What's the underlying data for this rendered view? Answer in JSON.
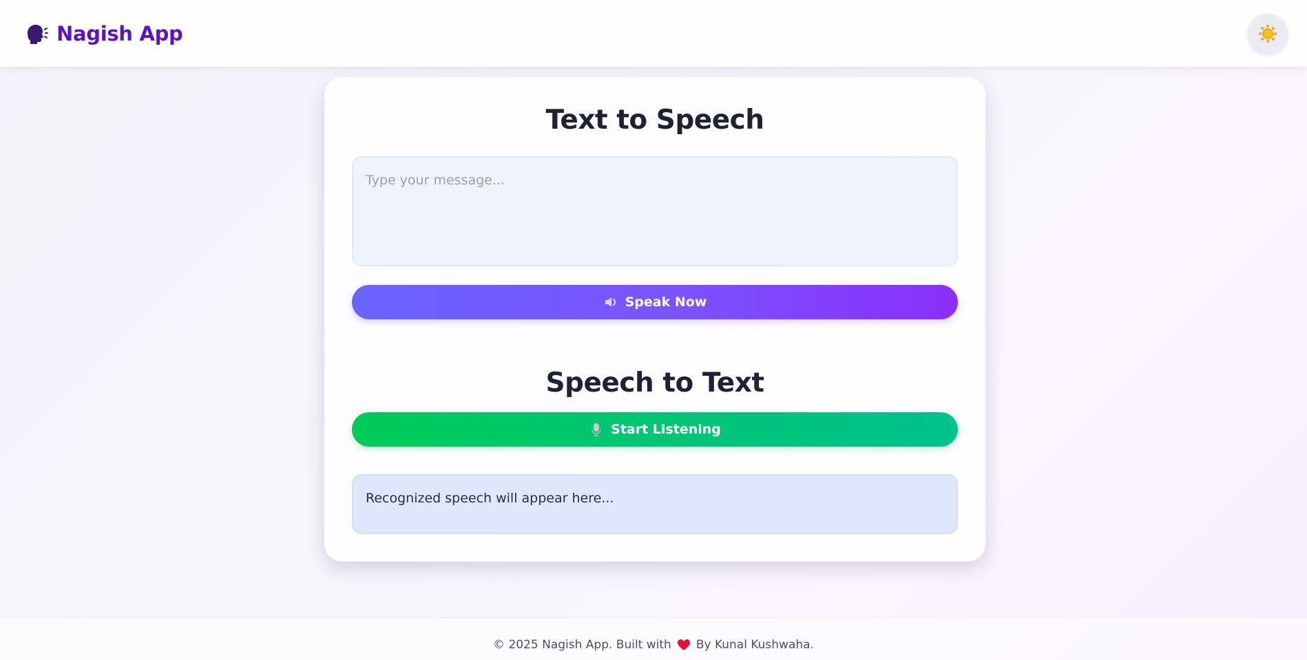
{
  "header": {
    "app_title": "Nagish App",
    "logo_icon": "speaking-head-icon",
    "theme_toggle_icon": "sun-icon"
  },
  "tts": {
    "title": "Text to Speech",
    "input_placeholder": "Type your message...",
    "input_value": "",
    "speak_button_label": "Speak Now",
    "speak_button_icon": "speaker-icon"
  },
  "stt": {
    "title": "Speech to Text",
    "listen_button_label": "Start Listening",
    "listen_button_icon": "microphone-icon",
    "result_text": "Recognized speech will appear here..."
  },
  "footer": {
    "text_before": "© 2025 Nagish App. Built with",
    "heart_icon": "heart-icon",
    "text_after": "By Kunal Kushwaha."
  },
  "colors": {
    "brand": "#5b13c9",
    "speak_gradient_start": "#6a63ff",
    "speak_gradient_end": "#8a2ff9",
    "listen_gradient_start": "#00cb57",
    "listen_gradient_end": "#00c28c",
    "heart": "#e8102e"
  }
}
